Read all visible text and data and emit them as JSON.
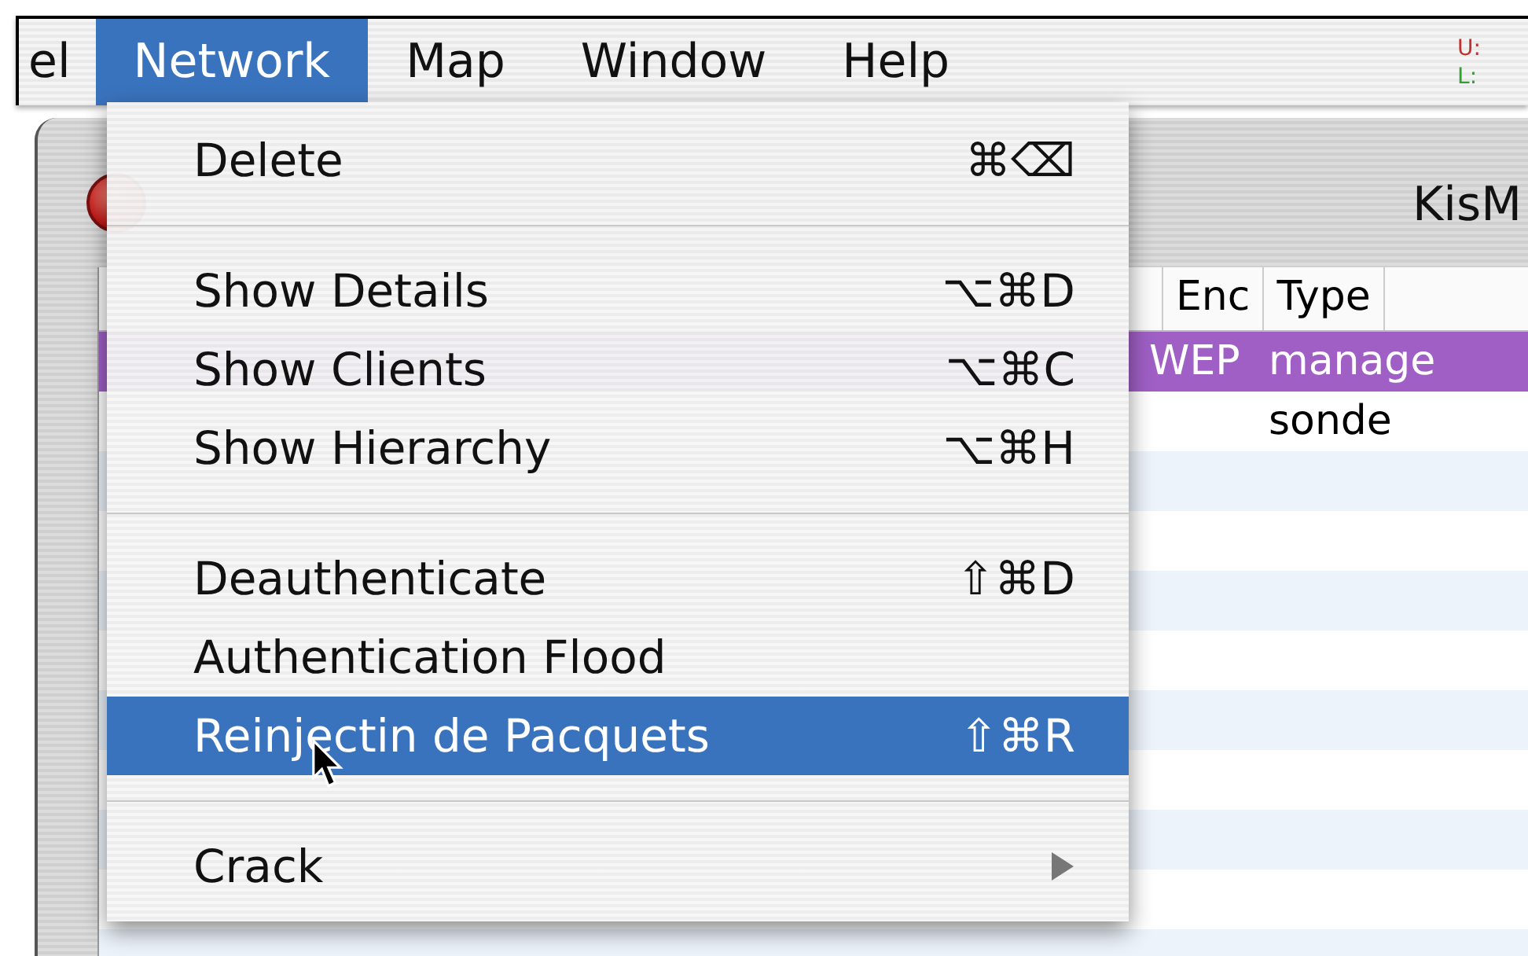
{
  "menu_bar": {
    "items": [
      {
        "label": "el",
        "selected": false
      },
      {
        "label": "Network",
        "selected": true
      },
      {
        "label": "Map",
        "selected": false
      },
      {
        "label": "Window",
        "selected": false
      },
      {
        "label": "Help",
        "selected": false
      }
    ],
    "status": [
      {
        "label": "U:",
        "color": "#c03030"
      },
      {
        "label": "L:",
        "color": "#30a030"
      }
    ]
  },
  "window": {
    "title": "KisM",
    "columns": [
      "Enc",
      "Type"
    ],
    "rows": [
      {
        "enc": "WEP",
        "type": "manage",
        "selected": true
      },
      {
        "type": "sonde",
        "selected": false
      }
    ]
  },
  "menu": {
    "items": [
      {
        "kind": "item",
        "label": "Delete",
        "shortcut": "⌘⌫",
        "selected": false
      },
      {
        "kind": "separator"
      },
      {
        "kind": "item",
        "label": "Show Details",
        "shortcut": "⌥⌘D",
        "selected": false
      },
      {
        "kind": "item",
        "label": "Show Clients",
        "shortcut": "⌥⌘C",
        "selected": false
      },
      {
        "kind": "item",
        "label": "Show Hierarchy",
        "shortcut": "⌥⌘H",
        "selected": false
      },
      {
        "kind": "separator"
      },
      {
        "kind": "item",
        "label": "Deauthenticate",
        "shortcut": "⇧⌘D",
        "selected": false
      },
      {
        "kind": "item",
        "label": "Authentication Flood",
        "selected": false
      },
      {
        "kind": "item",
        "label": "Reinjectin de Pacquets",
        "shortcut": "⇧⌘R",
        "selected": true
      },
      {
        "kind": "separator"
      },
      {
        "kind": "submenu",
        "label": "Crack",
        "selected": false
      }
    ]
  }
}
